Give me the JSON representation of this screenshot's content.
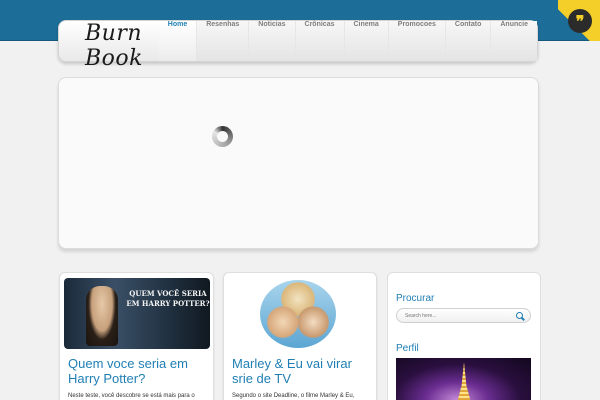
{
  "site": {
    "logo": "Burn Book"
  },
  "nav": {
    "items": [
      {
        "label": "Home",
        "active": true
      },
      {
        "label": "Resenhas"
      },
      {
        "label": "Noticias"
      },
      {
        "label": "Crônicas"
      },
      {
        "label": "Cinema"
      },
      {
        "label": "Promocoes"
      },
      {
        "label": "Contato"
      },
      {
        "label": "Anuncie"
      }
    ]
  },
  "posts": [
    {
      "image_text": "QUEM VOCÊ SERIA EM HARRY POTTER?",
      "title": "Quem voce seria em Harry Potter?",
      "excerpt": "Neste teste, você descobre se está mais para o"
    },
    {
      "title": "Marley & Eu vai virar srie de TV",
      "excerpt": "Segundo o site Deadline, o filme Marley & Eu,"
    }
  ],
  "sidebar": {
    "search_title": "Procurar",
    "search_placeholder": "Search here...",
    "profile_title": "Perfil"
  },
  "colors": {
    "top_band": "#1d6d99",
    "accent": "#1f7fb4",
    "corner": "#f4cf2a"
  },
  "icons": [
    "quote-icon",
    "loading-spinner-icon",
    "search-icon"
  ]
}
